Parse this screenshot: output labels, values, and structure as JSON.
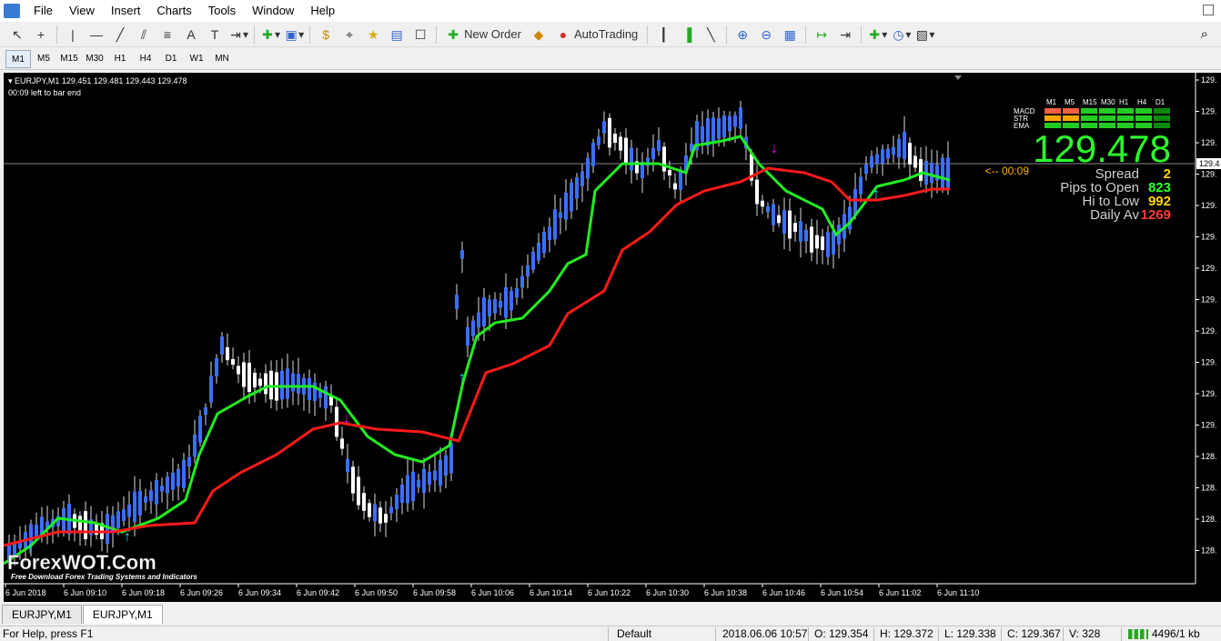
{
  "menu": [
    "File",
    "View",
    "Insert",
    "Charts",
    "Tools",
    "Window",
    "Help"
  ],
  "toolbar": {
    "new_order": "New Order",
    "autotrading": "AutoTrading"
  },
  "timeframes": [
    "M1",
    "M5",
    "M15",
    "M30",
    "H1",
    "H4",
    "D1",
    "W1",
    "MN"
  ],
  "active_timeframe": "M1",
  "chart": {
    "header": "EURJPY,M1  129.451 129.481 129.443 129.478",
    "bar_timer": "00:09 left to bar end",
    "current_price_label": "129.4",
    "timer_tag": "<-- 00:09",
    "watermark_title": "ForexWOT.Com",
    "watermark_sub": "Free Download Forex Trading Systems and Indicators",
    "y_tick_labels": [
      "129.",
      "129.",
      "129.",
      "129.",
      "129.",
      "129.",
      "129.",
      "129.",
      "129.",
      "129.",
      "129.",
      "129.",
      "128.",
      "128.",
      "128.",
      "128."
    ],
    "x_tick_labels": [
      "6 Jun 2018",
      "6 Jun 09:10",
      "6 Jun 09:18",
      "6 Jun 09:26",
      "6 Jun 09:34",
      "6 Jun 09:42",
      "6 Jun 09:50",
      "6 Jun 09:58",
      "6 Jun 10:06",
      "6 Jun 10:14",
      "6 Jun 10:22",
      "6 Jun 10:30",
      "6 Jun 10:38",
      "6 Jun 10:46",
      "6 Jun 10:54",
      "6 Jun 11:02",
      "6 Jun 11:10"
    ],
    "panel": {
      "columns": [
        "M1",
        "M5",
        "M15",
        "M30",
        "H1",
        "H4",
        "D1"
      ],
      "rows": [
        {
          "label": "MACD",
          "colors": [
            "#ff6040",
            "#ff6040",
            "#22cc22",
            "#22cc22",
            "#22cc22",
            "#22cc22",
            "#0a8a0a"
          ]
        },
        {
          "label": "STR",
          "colors": [
            "#ffa500",
            "#ffa500",
            "#22cc22",
            "#22cc22",
            "#22cc22",
            "#22cc22",
            "#0a8a0a"
          ]
        },
        {
          "label": "EMA",
          "colors": [
            "#22cc22",
            "#22cc22",
            "#22cc22",
            "#22cc22",
            "#22cc22",
            "#22cc22",
            "#0a8a0a"
          ]
        }
      ],
      "price": "129.478",
      "stats": [
        {
          "label": "Spread",
          "value": "2",
          "color": "#ffd700"
        },
        {
          "label": "Pips to Open",
          "value": "823",
          "color": "#33ff33"
        },
        {
          "label": "Hi to Low",
          "value": "992",
          "color": "#ffd700"
        },
        {
          "label": "Daily Av",
          "value": "1269",
          "color": "#ff3b3b"
        }
      ]
    }
  },
  "tabs": [
    "EURJPY,M1",
    "EURJPY,M1"
  ],
  "status": {
    "help": "For Help, press F1",
    "profile": "Default",
    "datetime": "2018.06.06 10:57",
    "open": "O: 129.354",
    "high": "H: 129.372",
    "low": "L: 129.338",
    "close": "C: 129.367",
    "volume": "V: 328",
    "traffic": "4496/1 kb"
  },
  "colors": {
    "bull": "#3b6fff",
    "bear": "#ffffff",
    "fast_line": "#22ee22",
    "slow_line": "#ff1a1a",
    "arrow_up": "#00e5ff",
    "arrow_down": "#ff00ff"
  }
}
